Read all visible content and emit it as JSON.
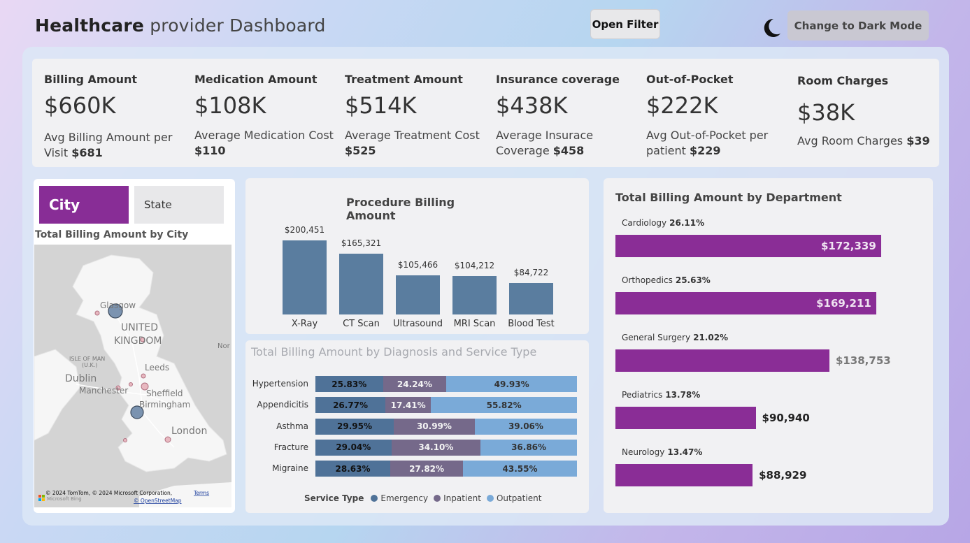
{
  "header": {
    "title_bold": "Healthcare",
    "title_rest": " provider Dashboard",
    "open_filter_label": "Open Filter",
    "dark_mode_label": "Change to Dark Mode"
  },
  "kpis": [
    {
      "label": "Billing Amount",
      "value": "$660K",
      "sub_text": "Avg Billing Amount per Visit ",
      "sub_value": "$681"
    },
    {
      "label": "Medication Amount",
      "value": "$108K",
      "sub_text": "Average Medication Cost ",
      "sub_value": "$110"
    },
    {
      "label": "Treatment Amount",
      "value": "$514K",
      "sub_text": "Average Treatment Cost ",
      "sub_value": "$525"
    },
    {
      "label": "Insurance coverage",
      "value": "$438K",
      "sub_text": "Average Insurace Coverage ",
      "sub_value": "$458"
    },
    {
      "label": "Out-of-Pocket",
      "value": "$222K",
      "sub_text": "Avg Out-of-Pocket per patient ",
      "sub_value": "$229"
    },
    {
      "label": "Room Charges",
      "value": "$38K",
      "sub_text": "Avg Room Charges ",
      "sub_value": "$39"
    }
  ],
  "map_card": {
    "tab_city": "City",
    "tab_state": "State",
    "title": "Total Billing Amount by City",
    "labels": {
      "glasgow": "Glasgow",
      "united": "UNITED",
      "kingdom": "KINGDOM",
      "isle": "ISLE OF MAN",
      "uk": "(U.K.)",
      "dublin": "Dublin",
      "leeds": "Leeds",
      "manchester": "Manchester",
      "sheffield": "Sheffield",
      "birmingham": "Birmingham",
      "london": "London",
      "nor": "Nor"
    },
    "attribution": "© 2024 TomTom, © 2024 Microsoft Corporation,",
    "terms": "Terms",
    "osm": "© OpenStreetMap",
    "bing": "Microsoft Bing"
  },
  "chart_data": [
    {
      "type": "bar",
      "title": "Procedure Billing Amount",
      "categories": [
        "X-Ray",
        "CT Scan",
        "Ultrasound",
        "MRI Scan",
        "Blood Test"
      ],
      "values": [
        200451,
        165321,
        105466,
        104212,
        84722
      ],
      "labels": [
        "$200,451",
        "$165,321",
        "$105,466",
        "$104,212",
        "$84,722"
      ],
      "color": "#5a7d9f"
    },
    {
      "type": "bar",
      "title": "Total Billing Amount by Diagnosis and Service Type",
      "stacked": true,
      "orientation": "horizontal",
      "categories": [
        "Hypertension",
        "Appendicitis",
        "Asthma",
        "Fracture",
        "Migraine"
      ],
      "legend_title": "Service Type",
      "series": [
        {
          "name": "Emergency",
          "color": "#4f7298",
          "values": [
            25.83,
            26.77,
            29.95,
            29.04,
            28.63
          ]
        },
        {
          "name": "Inpatient",
          "color": "#75698a",
          "values": [
            24.24,
            17.41,
            30.99,
            34.1,
            27.82
          ]
        },
        {
          "name": "Outpatient",
          "color": "#7aaad8",
          "values": [
            49.93,
            55.82,
            39.06,
            36.86,
            43.55
          ]
        }
      ]
    },
    {
      "type": "bar",
      "title": "Total Billing Amount by Department",
      "orientation": "horizontal",
      "categories": [
        "Cardiology",
        "Orthopedics",
        "General Surgery",
        "Pediatrics",
        "Neurology"
      ],
      "percent": [
        "26.11%",
        "25.63%",
        "21.02%",
        "13.78%",
        "13.47%"
      ],
      "values": [
        172339,
        169211,
        138753,
        90940,
        88929
      ],
      "labels": [
        "$172,339",
        "$169,211",
        "$138,753",
        "$90,940",
        "$88,929"
      ],
      "color": "#8a2d96"
    }
  ]
}
